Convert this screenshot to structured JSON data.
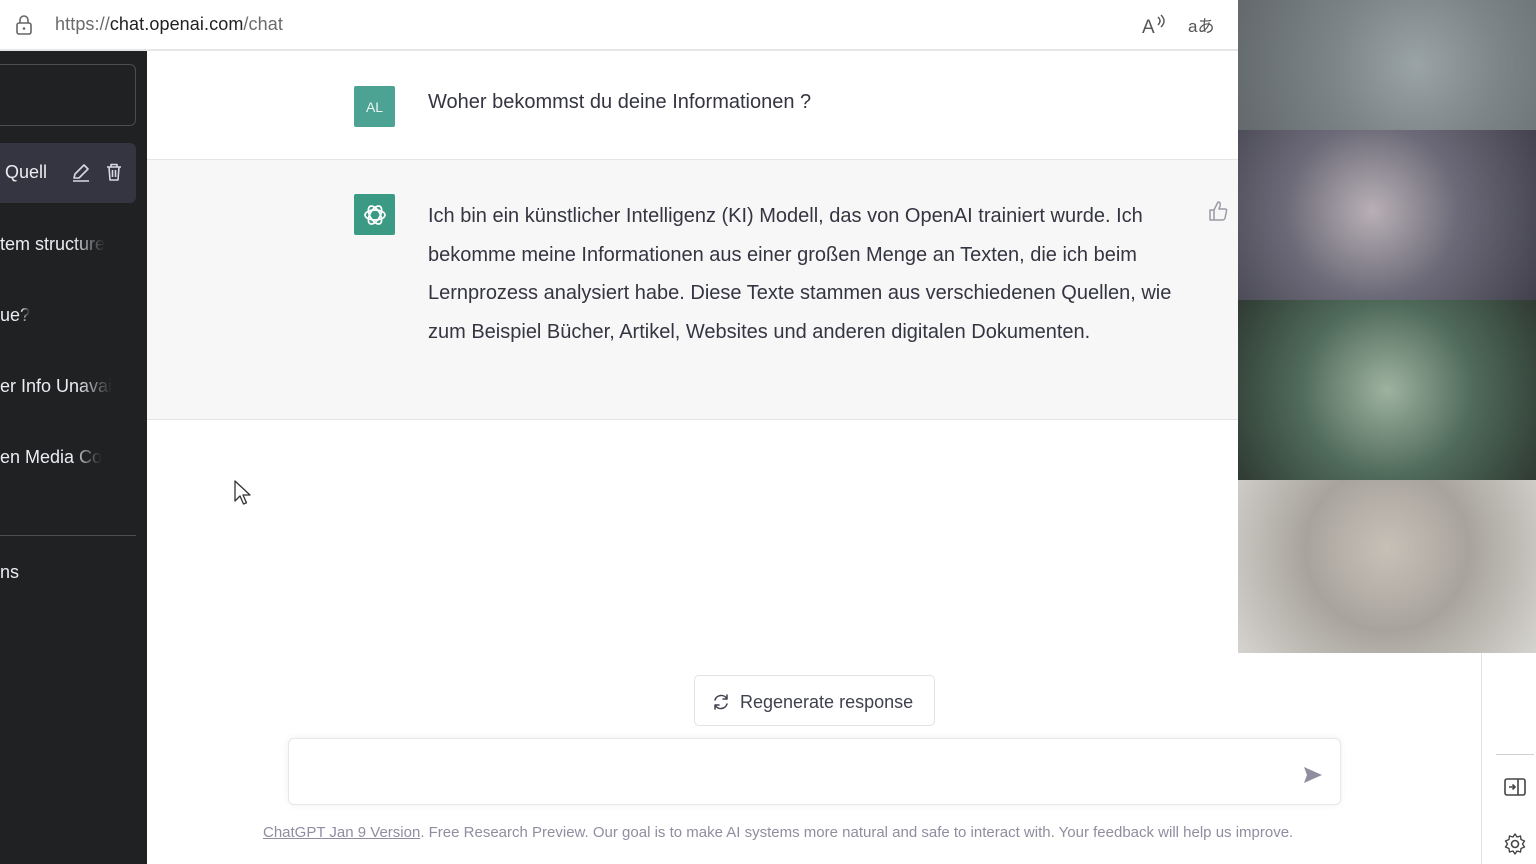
{
  "browser": {
    "url_prefix": "https://",
    "url_host": "chat.openai.com",
    "url_path": "/chat",
    "translate_glyph": "aあ"
  },
  "sidebar": {
    "conversations": [
      {
        "label": "Quell",
        "active": true
      },
      {
        "label": "tem structure"
      },
      {
        "label": "ue?"
      },
      {
        "label": "er Info Unavai"
      },
      {
        "label": "en Media Co"
      }
    ],
    "bottom_item": "ns"
  },
  "chat": {
    "user_avatar": "AL",
    "user_message": "Woher bekommst du deine Informationen ?",
    "bot_message": "Ich bin ein künstlicher Intelligenz (KI) Modell, das von OpenAI trainiert wurde. Ich bekomme meine Informationen aus einer großen Menge an Texten, die ich beim Lernprozess analysiert habe. Diese Texte stammen aus verschiedenen Quellen, wie zum Beispiel Bücher, Artikel, Websites und anderen digitalen Dokumenten."
  },
  "composer": {
    "regenerate_label": "Regenerate response",
    "input_value": ""
  },
  "footer": {
    "link_text": "ChatGPT Jan 9 Version",
    "text": ". Free Research Preview. Our goal is to make AI systems more natural and safe to interact with. Your feedback will help us improve."
  },
  "colors": {
    "sidebar_bg": "#202123",
    "accent": "#3a9a84",
    "user_avatar": "#4da393"
  }
}
